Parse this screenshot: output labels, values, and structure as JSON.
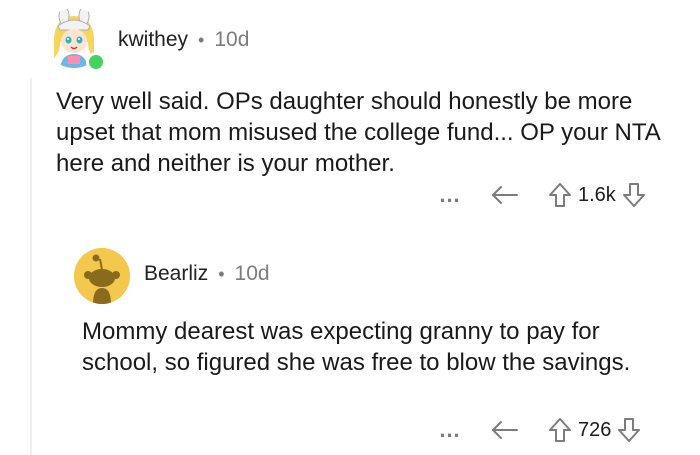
{
  "comments": [
    {
      "author": "kwithey",
      "separator": "•",
      "age": "10d",
      "body": "Very well said. OPs daughter should honestly be more upset that mom misused the college fund... OP your NTA here and neither is your mother.",
      "more": "...",
      "votes": "1.6k",
      "online": true
    },
    {
      "author": "Bearliz",
      "separator": "•",
      "age": "10d",
      "body": "Mommy dearest was expecting granny to pay for school, so figured she was free to blow the savings.",
      "more": "...",
      "votes": "726"
    }
  ],
  "colors": {
    "online": "#46d160",
    "avatar_yellow": "#f2c94c",
    "muted": "#7c7c7c",
    "thread_line": "#edeff1"
  },
  "icons": [
    "more-icon",
    "reply-icon",
    "upvote-icon",
    "downvote-icon"
  ]
}
